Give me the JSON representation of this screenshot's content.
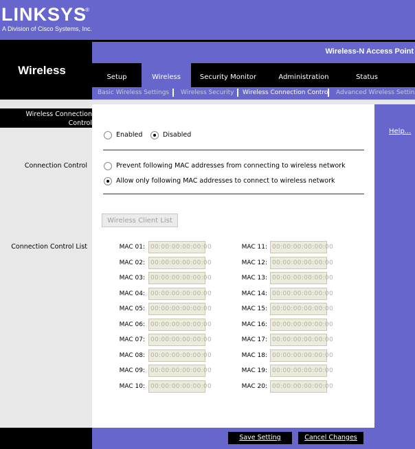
{
  "brand": {
    "logo": "LINKSYS",
    "registered": "®",
    "tagline": "A Division of Cisco Systems, Inc."
  },
  "section_title": "Wireless",
  "product_name": "Wireless-N Access Point",
  "tabs": [
    {
      "label": "Setup",
      "active": false
    },
    {
      "label": "Wireless",
      "active": true
    },
    {
      "label": "Security Monitor",
      "active": false
    },
    {
      "label": "Administration",
      "active": false
    },
    {
      "label": "Status",
      "active": false
    }
  ],
  "subtabs": [
    {
      "label": "Basic Wireless Settings",
      "active": false
    },
    {
      "label": "Wireless Security",
      "active": false
    },
    {
      "label": "Wireless Connection Control",
      "active": true
    },
    {
      "label": "Advanced Wireless Settings",
      "active": false
    }
  ],
  "left_header": "Wireless Connection Control",
  "left_header_lines": [
    "Wireless Connection",
    "Control"
  ],
  "labels": {
    "connection_control": "Connection Control",
    "connection_control_list": "Connection Control List"
  },
  "help_link": "Help...",
  "enable_options": {
    "enabled": {
      "label": "Enabled",
      "selected": false
    },
    "disabled": {
      "label": "Disabled",
      "selected": true
    }
  },
  "mode_options": {
    "prevent": {
      "label": "Prevent following MAC addresses from connecting to wireless network",
      "selected": false
    },
    "allow": {
      "label": "Allow only following MAC addresses to connect to wireless network",
      "selected": true
    }
  },
  "wireless_client_list_button": "Wireless Client List",
  "mac_entries_left": [
    {
      "label": "MAC 01:",
      "value": "00:00:00:00:00:00"
    },
    {
      "label": "MAC 02:",
      "value": "00:00:00:00:00:00"
    },
    {
      "label": "MAC 03:",
      "value": "00:00:00:00:00:00"
    },
    {
      "label": "MAC 04:",
      "value": "00:00:00:00:00:00"
    },
    {
      "label": "MAC 05:",
      "value": "00:00:00:00:00:00"
    },
    {
      "label": "MAC 06:",
      "value": "00:00:00:00:00:00"
    },
    {
      "label": "MAC 07:",
      "value": "00:00:00:00:00:00"
    },
    {
      "label": "MAC 08:",
      "value": "00:00:00:00:00:00"
    },
    {
      "label": "MAC 09:",
      "value": "00:00:00:00:00:00"
    },
    {
      "label": "MAC 10:",
      "value": "00:00:00:00:00:00"
    }
  ],
  "mac_entries_right": [
    {
      "label": "MAC 11:",
      "value": "00:00:00:00:00:00"
    },
    {
      "label": "MAC 12:",
      "value": "00:00:00:00:00:00"
    },
    {
      "label": "MAC 13:",
      "value": "00:00:00:00:00:00"
    },
    {
      "label": "MAC 14:",
      "value": "00:00:00:00:00:00"
    },
    {
      "label": "MAC 15:",
      "value": "00:00:00:00:00:00"
    },
    {
      "label": "MAC 16:",
      "value": "00:00:00:00:00:00"
    },
    {
      "label": "MAC 17:",
      "value": "00:00:00:00:00:00"
    },
    {
      "label": "MAC 18:",
      "value": "00:00:00:00:00:00"
    },
    {
      "label": "MAC 19:",
      "value": "00:00:00:00:00:00"
    },
    {
      "label": "MAC 20:",
      "value": "00:00:00:00:00:00"
    }
  ],
  "buttons": {
    "save": "Save Setting",
    "cancel": "Cancel Changes"
  },
  "colors": {
    "brand_purple": "#6666cc",
    "black": "#000000",
    "content_bg": "#ffffff",
    "left_bg": "#e8e8e8"
  }
}
